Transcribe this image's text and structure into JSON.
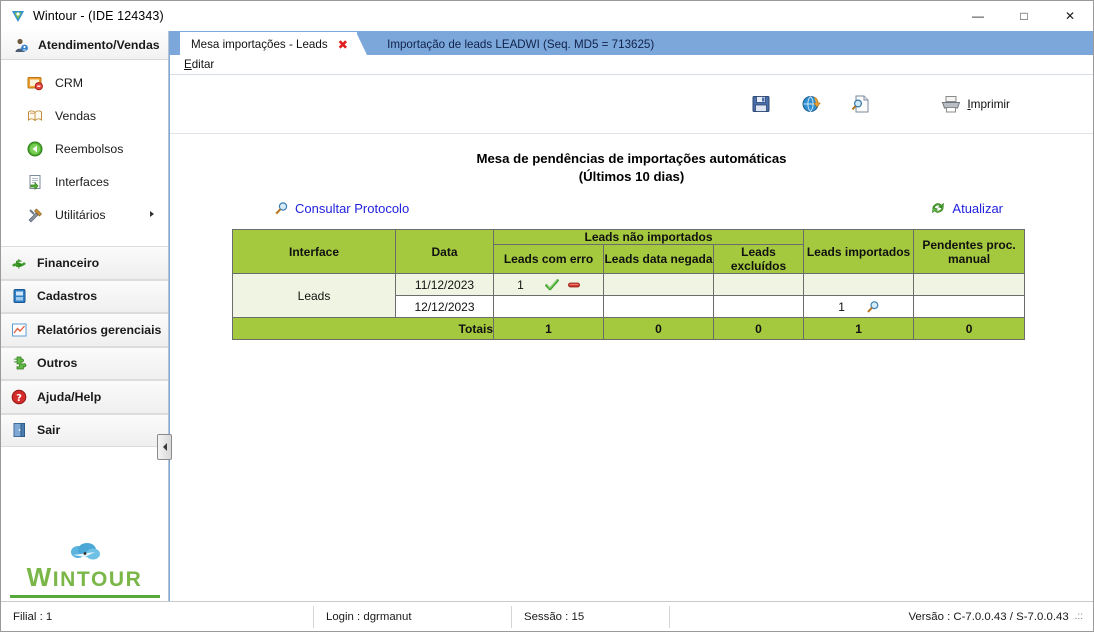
{
  "window": {
    "title": "Wintour - (IDE 124343)",
    "app_icon": "wintour-logo-icon",
    "minimize": "—",
    "maximize": "□",
    "close": "✕"
  },
  "sidebar": {
    "header": {
      "label": "Atendimento/Vendas",
      "icon": "user-headset-icon"
    },
    "sub_items": [
      {
        "label": "CRM",
        "icon": "crm-card-icon",
        "has_arrow": false
      },
      {
        "label": "Vendas",
        "icon": "book-icon",
        "has_arrow": false
      },
      {
        "label": "Reembolsos",
        "icon": "green-back-arrow-icon",
        "has_arrow": false
      },
      {
        "label": "Interfaces",
        "icon": "document-arrow-icon",
        "has_arrow": false
      },
      {
        "label": "Utilitários",
        "icon": "hammer-wrench-icon",
        "has_arrow": true
      }
    ],
    "groups": [
      {
        "label": "Financeiro",
        "icon": "money-icon"
      },
      {
        "label": "Cadastros",
        "icon": "database-card-icon"
      },
      {
        "label": "Relatórios gerenciais",
        "icon": "chart-icon"
      },
      {
        "label": "Outros",
        "icon": "puzzle-icon"
      },
      {
        "label": "Ajuda/Help",
        "icon": "question-help-icon"
      },
      {
        "label": "Sair",
        "icon": "exit-door-icon"
      }
    ],
    "logo": {
      "first_letter": "W",
      "rest": "INTOUR",
      "icon": "cloud-icon"
    }
  },
  "workspace": {
    "tab": {
      "label": "Mesa importações - Leads",
      "close": "✖"
    },
    "header_text": "Importação de leads LEADWI (Seq. MD5 = 713625)",
    "menu": [
      {
        "accel": "E",
        "rest": "ditar"
      }
    ],
    "toolbar": [
      {
        "name": "save-button",
        "icon": "floppy-disk-icon",
        "label": ""
      },
      {
        "name": "export-button",
        "icon": "refresh-globe-icon",
        "label": ""
      },
      {
        "name": "preview-button",
        "icon": "document-search-icon",
        "label": ""
      },
      {
        "name": "print-button",
        "icon": "printer-icon",
        "label": "Imprimir",
        "accel": "I",
        "label_rest": "mprimir"
      }
    ],
    "title_line1": "Mesa de pendências de importações automáticas",
    "title_line2": "(Últimos 10 dias)",
    "links": {
      "consult": {
        "label": "Consultar Protocolo",
        "icon": "magnifier-icon"
      },
      "refresh": {
        "label": "Atualizar",
        "icon": "refresh-green-icon"
      }
    }
  },
  "table": {
    "headers": {
      "interface": "Interface",
      "data": "Data",
      "nao_importados_group": "Leads não importados",
      "com_erro": "Leads com erro",
      "data_negada": "Leads data negada",
      "excluidos": "Leads excluídos",
      "importados": "Leads importados",
      "pendentes": "Pendentes proc. manual"
    },
    "interface_name": "Leads",
    "rows": [
      {
        "data": "11/12/2023",
        "com_erro": "1",
        "com_erro_icons": [
          "check-green-icon",
          "minus-red-icon"
        ],
        "data_negada": "",
        "excluidos": "",
        "importados": "",
        "importados_icons": [],
        "pendentes": ""
      },
      {
        "data": "12/12/2023",
        "com_erro": "",
        "com_erro_icons": [],
        "data_negada": "",
        "excluidos": "",
        "importados": "1",
        "importados_icons": [
          "magnifier-icon"
        ],
        "pendentes": ""
      }
    ],
    "totals": {
      "label": "Totais",
      "com_erro": "1",
      "data_negada": "0",
      "excluidos": "0",
      "importados": "1",
      "pendentes": "0"
    },
    "colors": {
      "header_green": "#a4c93e",
      "row_alt": "#f0f4e2",
      "border": "#6c6c6c"
    }
  },
  "statusbar": {
    "filial": "Filial : 1",
    "login": "Login : dgrmanut",
    "sessao": "Sessão : 15",
    "versao": "Versão : C-7.0.0.43 / S-7.0.0.43",
    "grip": ".::"
  }
}
